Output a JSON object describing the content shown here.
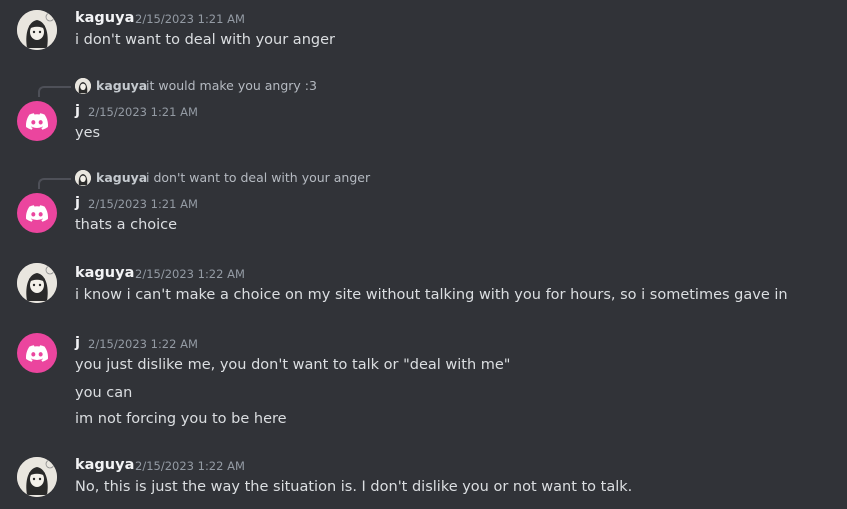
{
  "messages": [
    {
      "author": "kaguya",
      "timestamp": "2/15/2023 1:21 AM",
      "lines": [
        "i don't want to deal with your anger"
      ]
    },
    {
      "author": "j",
      "timestamp": "2/15/2023 1:21 AM",
      "reply": {
        "author": "kaguya",
        "text": "it would make you angry :3"
      },
      "lines": [
        "yes"
      ]
    },
    {
      "author": "j",
      "timestamp": "2/15/2023 1:21 AM",
      "reply": {
        "author": "kaguya",
        "text": "i don't want to deal with your anger"
      },
      "lines": [
        "thats a choice"
      ]
    },
    {
      "author": "kaguya",
      "timestamp": "2/15/2023 1:22 AM",
      "lines": [
        "i know i can't make a choice on my site without talking with you for hours, so i sometimes gave in"
      ]
    },
    {
      "author": "j",
      "timestamp": "2/15/2023 1:22 AM",
      "lines": [
        "you just dislike me, you don't want to talk or \"deal with me\"",
        "you can",
        "im not forcing you to be here"
      ]
    },
    {
      "author": "kaguya",
      "timestamp": "2/15/2023 1:22 AM",
      "lines": [
        "No, this is just the way the situation is. I don't dislike you or not want to talk."
      ]
    }
  ],
  "colors": {
    "background": "#313338",
    "discord_avatar": "#eb459e",
    "username": "#f2f3f5",
    "timestamp": "#949ba4"
  }
}
